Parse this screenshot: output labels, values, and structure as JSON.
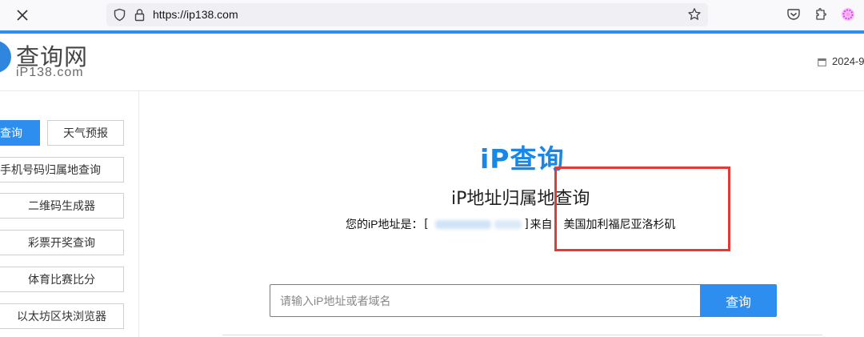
{
  "browser": {
    "url": "https://ip138.com",
    "colors": {
      "accent_line": "#2e8eef",
      "bar_bg": "#f9f9fb"
    },
    "icons": [
      "close-icon",
      "shield-icon",
      "lock-icon",
      "star-icon",
      "pocket-icon",
      "extensions-icon",
      "profile-icon"
    ]
  },
  "header": {
    "logo_title": "查询网",
    "logo_sub": "iP138.com",
    "date": "2024-9"
  },
  "sidebar": {
    "items": [
      {
        "label": "查询",
        "active": true
      },
      {
        "label": "天气预报"
      },
      {
        "label": "手机号码归属地查询"
      },
      {
        "label": "二维码生成器"
      },
      {
        "label": "彩票开奖查询"
      },
      {
        "label": "体育比赛比分"
      },
      {
        "label": "以太坊区块浏览器"
      }
    ]
  },
  "main": {
    "heading": "iP查询",
    "subheading": "iP地址归属地查询",
    "ip_prefix": "您的iP地址是：",
    "ip_open": "[",
    "ip_close": "]",
    "from_label": "来自：",
    "location": "美国加利福尼亚洛杉矶",
    "search": {
      "placeholder": "请输入iP地址或者域名",
      "button": "查询"
    },
    "colors": {
      "primary": "#2e8eef",
      "heading": "#1787e8",
      "highlight_box": "#e53935"
    }
  }
}
